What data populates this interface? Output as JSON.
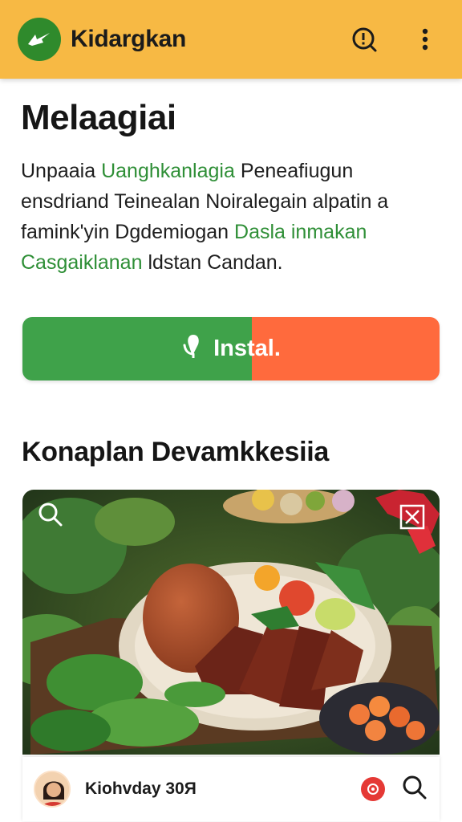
{
  "appbar": {
    "brand": "Kidargkan",
    "info_icon": "alert-circle-icon",
    "menu_icon": "more-vertical-icon",
    "color": "#f7b944"
  },
  "main": {
    "title": "Melaagiai",
    "description": {
      "part1": "Unpaaia ",
      "link1": "Uanghkanlagia",
      "part2": " Peneafiugun ensdriand Teinealan Noiralegain alpatin a famink'yin Dgdemiogan ",
      "link2": "Dasla inmakan Casgaiklanan",
      "part3": " ldstan Candan."
    },
    "install": {
      "label": "Instal.",
      "icon": "microphone-icon",
      "color_left": "#3fa24a",
      "color_right": "#ff6a3d"
    },
    "section_title": "Konaplan Devamkkesiia"
  },
  "card": {
    "image": "food-plate-photo",
    "zoom_icon": "search-icon",
    "close_icon": "close-box-icon",
    "author": "Kiohvday 30Я",
    "avatar": "avatar-icon",
    "badge_icon": "record-badge-icon",
    "search_icon": "search-icon"
  },
  "accent_green": "#2f8f37"
}
